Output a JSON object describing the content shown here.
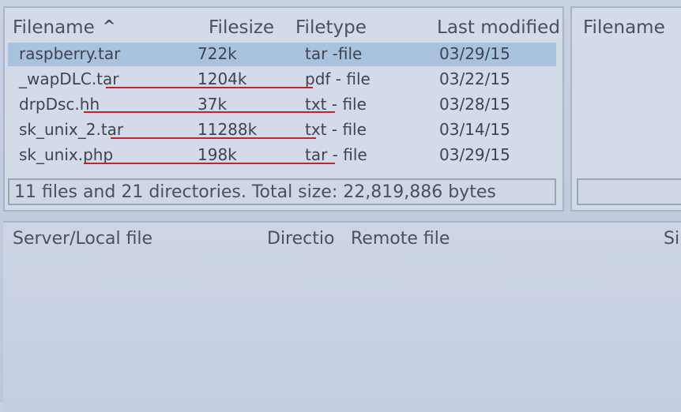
{
  "local_list": {
    "headers": {
      "filename": "Filename",
      "filesize": "Filesize",
      "filetype": "Filetype",
      "last_modified": "Last modified"
    },
    "sort_indicator": "^",
    "rows": [
      {
        "name": "raspberry.tar",
        "size": "722k",
        "type": "tar -file",
        "date": "03/29/15",
        "selected": true
      },
      {
        "name": "_wapDLC.tar",
        "size": "1204k",
        "type": "pdf - file",
        "date": "03/22/15",
        "selected": false
      },
      {
        "name": "drpDsc.hh",
        "size": "37k",
        "type": "txt - file",
        "date": "03/28/15",
        "selected": false
      },
      {
        "name": "sk_unix_2.tar",
        "size": "11288k",
        "type": "txt - file",
        "date": "03/14/15",
        "selected": false
      },
      {
        "name": "sk_unix.php",
        "size": "198k",
        "type": "tar - file",
        "date": "03/29/15",
        "selected": false
      }
    ],
    "status": "11 files and 21 directories. Total size: 22,819,886 bytes"
  },
  "remote_list": {
    "headers": {
      "filename": "Filename"
    }
  },
  "transfer_queue": {
    "headers": {
      "server_local": "Server/Local file",
      "direction": "Directio",
      "remote": "Remote file",
      "size": "Si"
    }
  },
  "annotation_color": "#c8232c",
  "selected_row_color": "#a9c3de"
}
